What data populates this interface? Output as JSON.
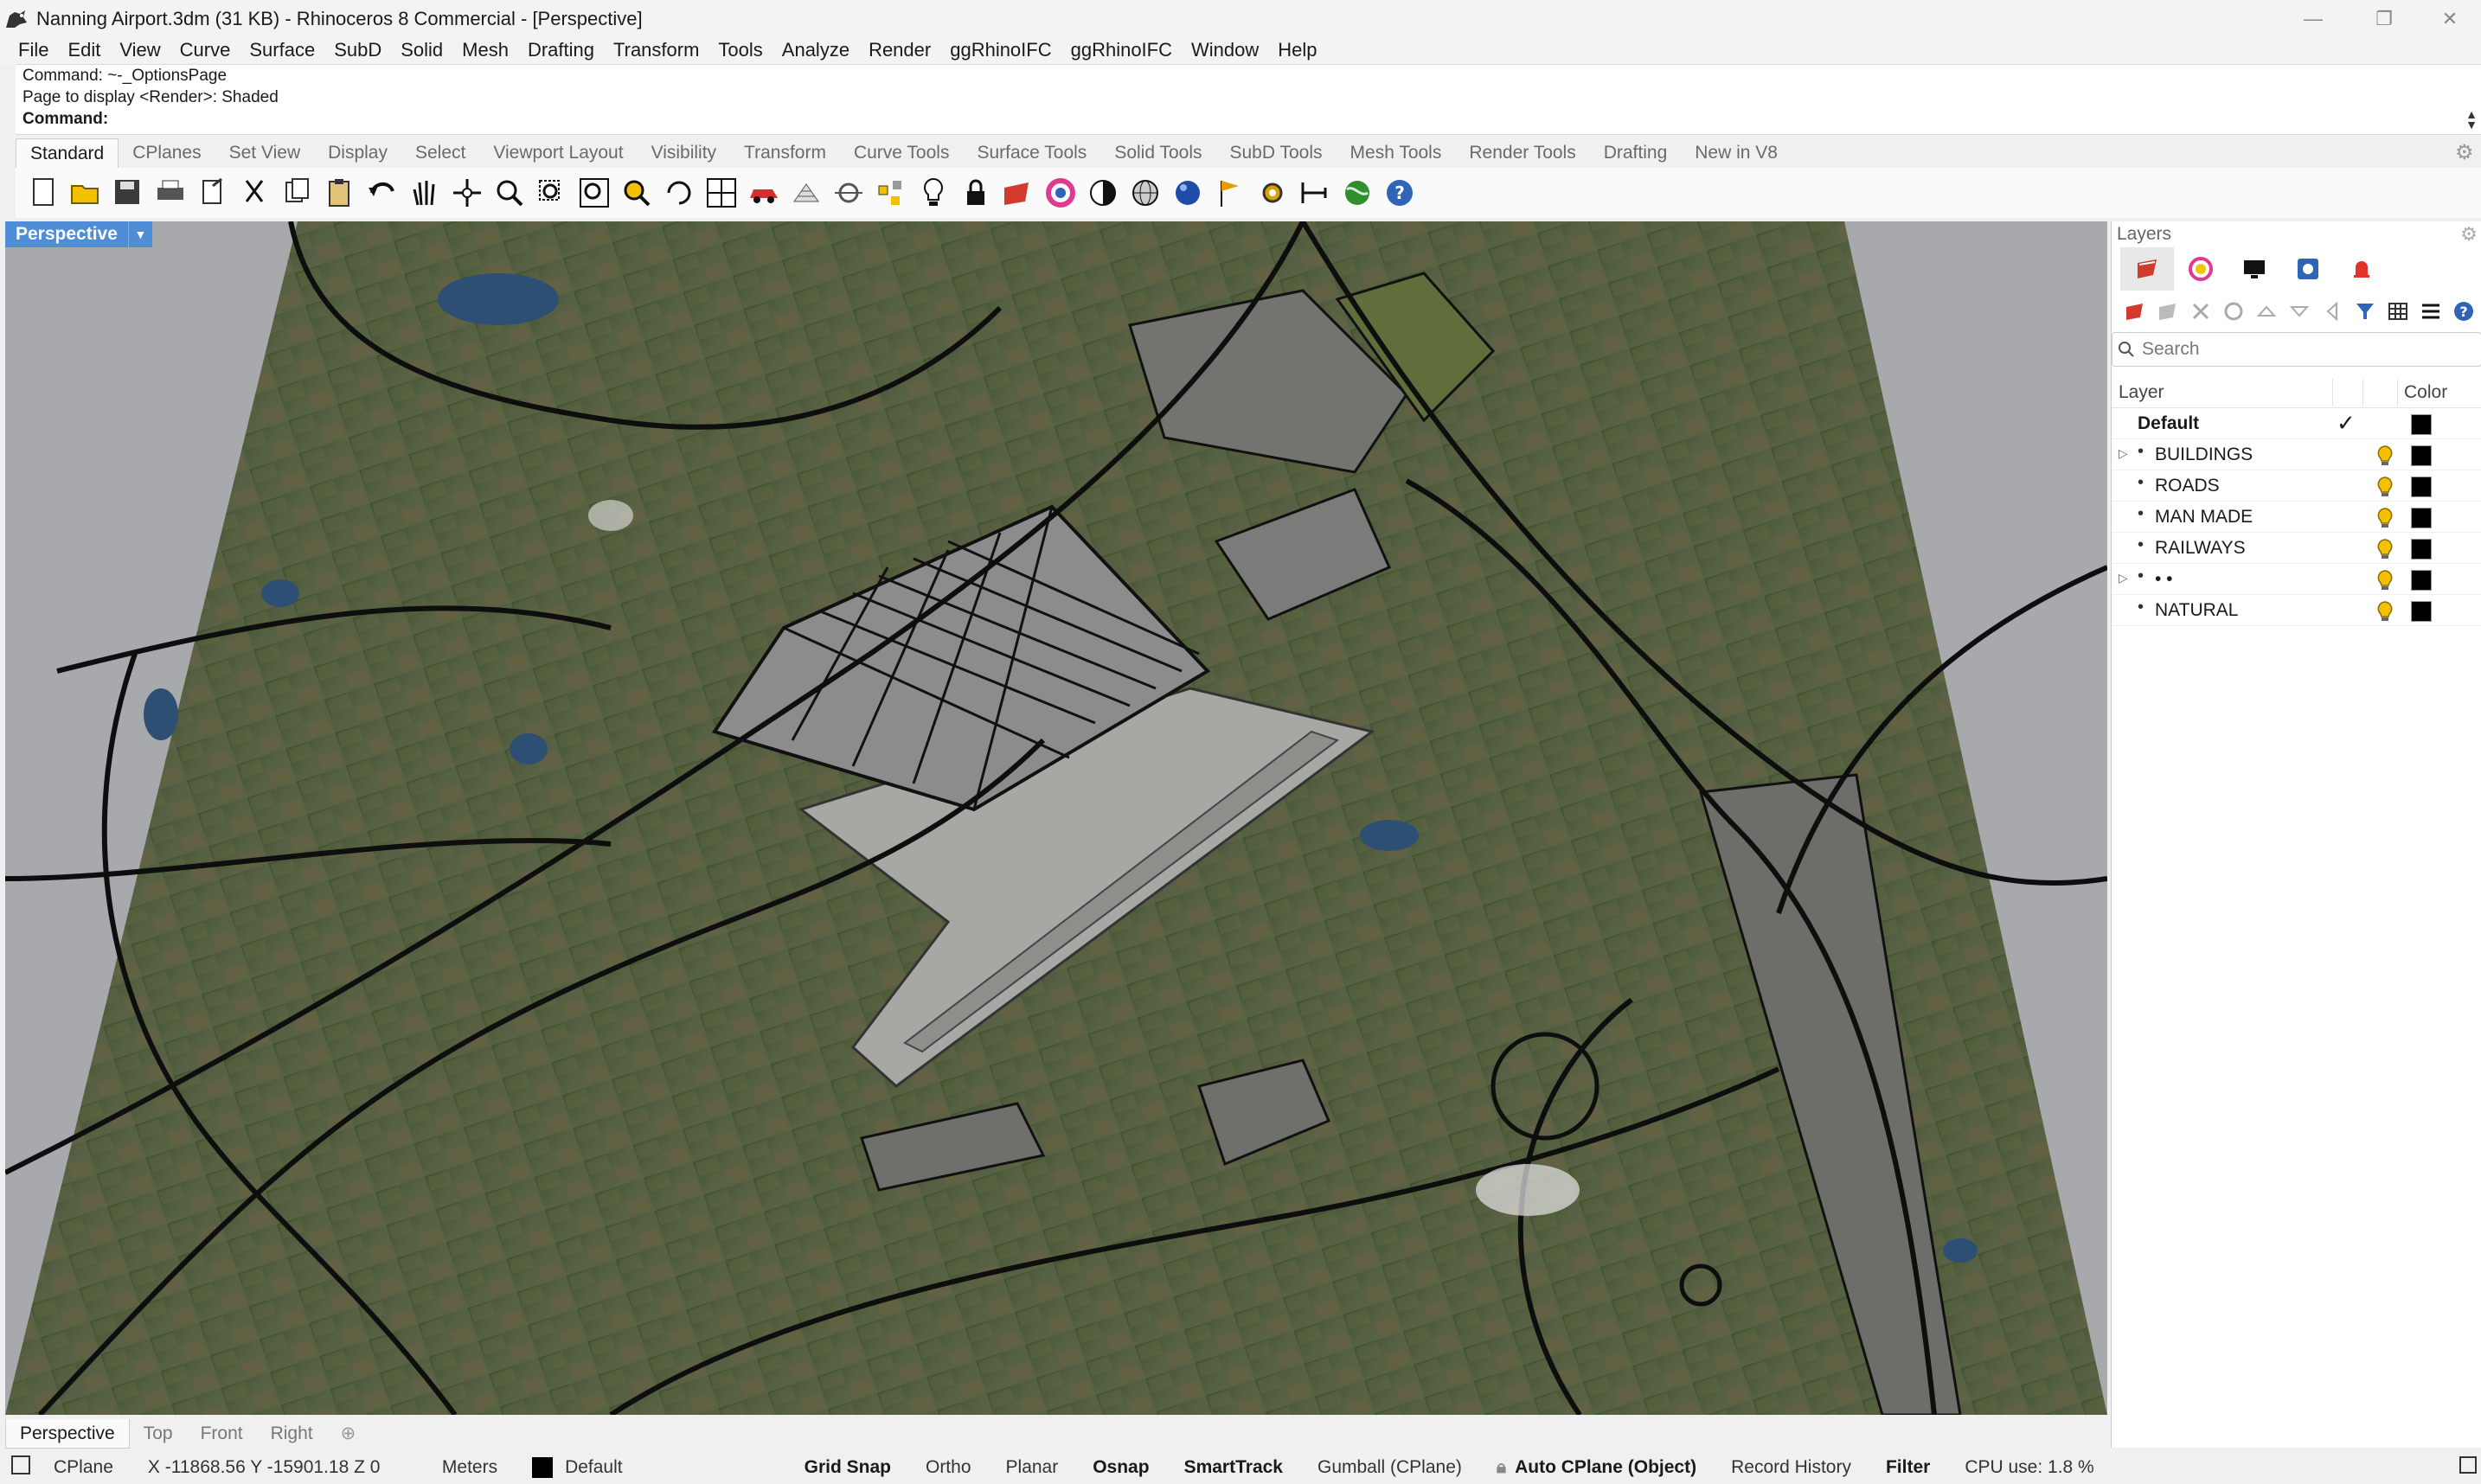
{
  "window": {
    "title": "Nanning Airport.3dm (31 KB) - Rhinoceros 8 Commercial - [Perspective]",
    "controls": [
      "—",
      "❐",
      "✕"
    ]
  },
  "menu": [
    "File",
    "Edit",
    "View",
    "Curve",
    "Surface",
    "SubD",
    "Solid",
    "Mesh",
    "Drafting",
    "Transform",
    "Tools",
    "Analyze",
    "Render",
    "ggRhinoIFC",
    "ggRhinoIFC",
    "Window",
    "Help"
  ],
  "command": {
    "history_1": "Command: ~-_OptionsPage",
    "history_2": "Page to display <Render>: Shaded",
    "prompt": "Command:",
    "value": ""
  },
  "toolbar_tabs": [
    "Standard",
    "CPlanes",
    "Set View",
    "Display",
    "Select",
    "Viewport Layout",
    "Visibility",
    "Transform",
    "Curve Tools",
    "Surface Tools",
    "Solid Tools",
    "SubD Tools",
    "Mesh Tools",
    "Render Tools",
    "Drafting",
    "New in V8"
  ],
  "toolbar_active_tab": "Standard",
  "tools": [
    "new-icon",
    "open-icon",
    "save-icon",
    "print-icon",
    "import-icon",
    "cut-icon",
    "copy-icon",
    "paste-icon",
    "undo-icon",
    "pan-icon",
    "move-icon",
    "zoom-icon",
    "zoom-window-icon",
    "zoom-extents-icon",
    "zoom-selected-icon",
    "rotate-view-icon",
    "four-viewports-icon",
    "car-icon",
    "grid-icon",
    "cplane-icon",
    "points-icon",
    "light-icon",
    "lock-icon",
    "layer-icon",
    "color-icon",
    "display-mode-icon",
    "wireframe-icon",
    "render-sphere-icon",
    "flag-icon",
    "settings-icon",
    "dimension-icon",
    "globe-icon",
    "help-icon"
  ],
  "viewport": {
    "name": "Perspective",
    "tabs": [
      "Perspective",
      "Top",
      "Front",
      "Right"
    ],
    "active_tab": "Perspective",
    "add_tab": "⊕"
  },
  "layers_panel": {
    "title": "Layers",
    "search_placeholder": "Search",
    "col_layer": "Layer",
    "col_color": "Color",
    "rows": [
      {
        "name": "Default",
        "current": true,
        "expandable": false,
        "color": "#000000"
      },
      {
        "name": "BUILDINGS",
        "current": false,
        "expandable": true,
        "color": "#000000"
      },
      {
        "name": "ROADS",
        "current": false,
        "expandable": false,
        "color": "#000000"
      },
      {
        "name": "MAN MADE",
        "current": false,
        "expandable": false,
        "color": "#000000"
      },
      {
        "name": "RAILWAYS",
        "current": false,
        "expandable": false,
        "color": "#000000"
      },
      {
        "name": "• •",
        "current": false,
        "expandable": true,
        "color": "#000000"
      },
      {
        "name": "NATURAL",
        "current": false,
        "expandable": false,
        "color": "#000000"
      }
    ]
  },
  "status": {
    "cplane": "CPlane",
    "coords": "X -11868.56 Y -15901.18 Z 0",
    "units": "Meters",
    "layer": "Default",
    "grid_snap": "Grid Snap",
    "ortho": "Ortho",
    "planar": "Planar",
    "osnap": "Osnap",
    "smarttrack": "SmartTrack",
    "gumball": "Gumball (CPlane)",
    "auto_cplane": "Auto CPlane (Object)",
    "record_history": "Record History",
    "filter": "Filter",
    "cpu": "CPU use: 1.8 %"
  },
  "colors": {
    "viewport_label": "#4f8ed6",
    "terrain": "#4a5a36",
    "runway": "#a8a8a4",
    "bulb": "#f2c200"
  }
}
